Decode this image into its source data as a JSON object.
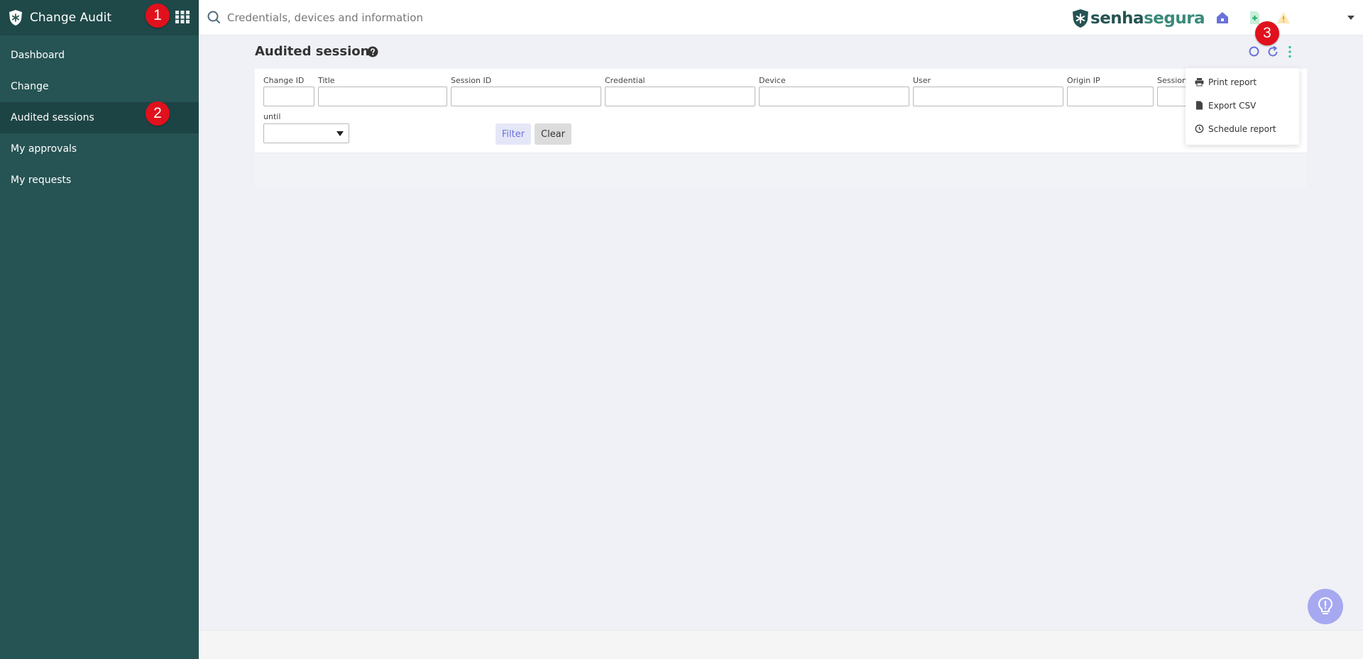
{
  "app": {
    "title": "Change Audit"
  },
  "sidebar": {
    "items": [
      {
        "label": "Dashboard"
      },
      {
        "label": "Change"
      },
      {
        "label": "Audited sessions"
      },
      {
        "label": "My approvals"
      },
      {
        "label": "My requests"
      }
    ]
  },
  "topbar": {
    "search_placeholder": "Credentials, devices and information",
    "brand_bold": "senha",
    "brand_light": "segura"
  },
  "page": {
    "title": "Audited sessions"
  },
  "filters": {
    "fields": [
      "Change ID",
      "Title",
      "Session ID",
      "Credential",
      "Device",
      "User",
      "Origin IP",
      "Session"
    ],
    "until_label": "until",
    "filter_button": "Filter",
    "clear_button": "Clear"
  },
  "menu": {
    "items": [
      "Print report",
      "Export CSV",
      "Schedule report"
    ]
  },
  "markers": [
    "1",
    "2",
    "3"
  ],
  "colors": {
    "sidebar": "#265353",
    "accent": "#6b72d8",
    "marker": "#e0111c",
    "teal_dots": "#3ec3a0"
  }
}
